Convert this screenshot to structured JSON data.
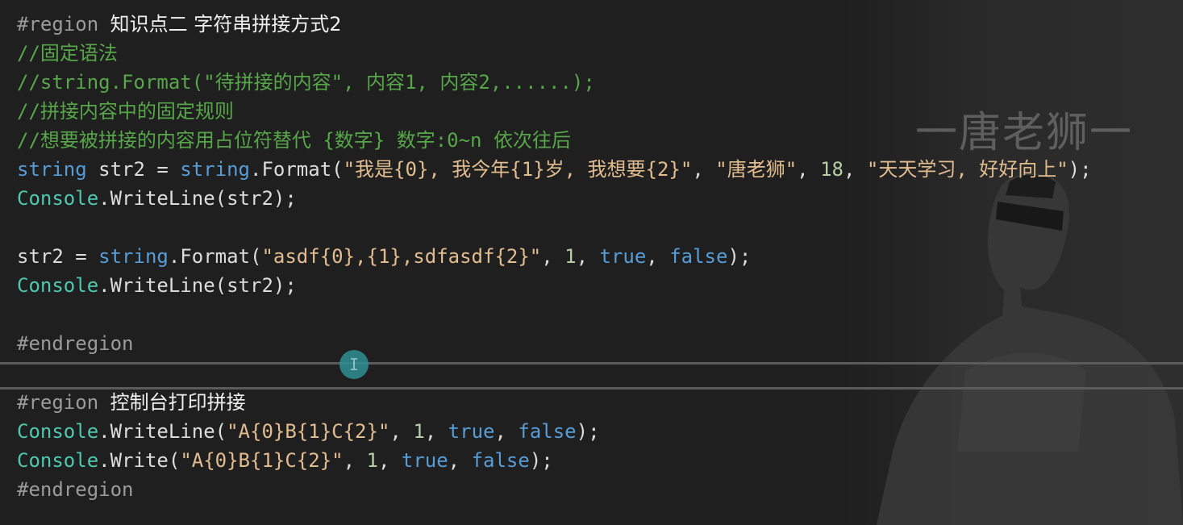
{
  "watermark": "一唐老狮一",
  "lines": {
    "l01_dir": "#region ",
    "l01_name": "知识点二 字符串拼接方式2",
    "l02": "//固定语法",
    "l03": "//string.Format(\"待拼接的内容\", 内容1, 内容2,......);",
    "l04": "//拼接内容中的固定规则",
    "l05": "//想要被拼接的内容用占位符替代 {数字} 数字:0~n 依次往后",
    "l06": {
      "t1": "string",
      "t2": " str2 = ",
      "t3": "string",
      "t4": ".Format(",
      "t5": "\"我是{0}, 我今年{1}岁, 我想要{2}\"",
      "t6": ", ",
      "t7": "\"唐老狮\"",
      "t8": ", ",
      "t9": "18",
      "t10": ", ",
      "t11": "\"天天学习, 好好向上\"",
      "t12": ");"
    },
    "l07": {
      "t1": "Console",
      "t2": ".WriteLine(str2);"
    },
    "l09": {
      "t1": "str2 = ",
      "t2": "string",
      "t3": ".Format(",
      "t4": "\"asdf{0},{1},sdfasdf{2}\"",
      "t5": ", ",
      "t6": "1",
      "t7": ", ",
      "t8": "true",
      "t9": ", ",
      "t10": "false",
      "t11": ");"
    },
    "l10": {
      "t1": "Console",
      "t2": ".WriteLine(str2);"
    },
    "l12": "#endregion",
    "l13_dir": "#region ",
    "l13_name": "控制台打印拼接",
    "l14": {
      "t1": "Console",
      "t2": ".WriteLine(",
      "t3": "\"A{0}B{1}C{2}\"",
      "t4": ", ",
      "t5": "1",
      "t6": ", ",
      "t7": "true",
      "t8": ", ",
      "t9": "false",
      "t10": ");"
    },
    "l15": {
      "t1": "Console",
      "t2": ".Write(",
      "t3": "\"A{0}B{1}C{2}\"",
      "t4": ", ",
      "t5": "1",
      "t6": ", ",
      "t7": "true",
      "t8": ", ",
      "t9": "false",
      "t10": ");"
    },
    "l16": "#endregion"
  },
  "cursor_icon": "I",
  "colors": {
    "background": "#1f1f1f",
    "comment": "#57a64a",
    "keyword": "#569cd6",
    "type": "#4ec9b0",
    "string": "#e1bc8f",
    "number": "#b5cea8",
    "directive": "#9b9b9b"
  },
  "icons": {
    "cursor": "text-cursor-icon",
    "artwork": "character-silhouette-icon"
  }
}
